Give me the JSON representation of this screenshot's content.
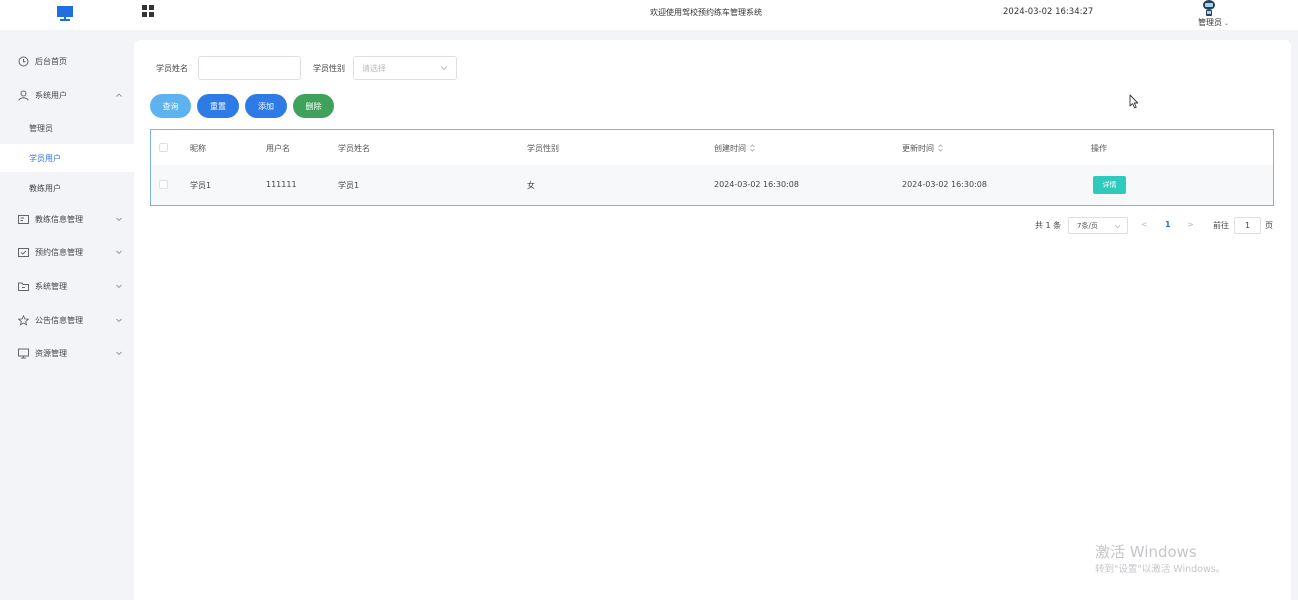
{
  "header": {
    "system_title": "欢迎使用驾校预约练车管理系统",
    "datetime": "2024-03-02 16:34:27",
    "user_role": "管理员",
    "icons": {
      "logo": "monitor-icon",
      "menu": "grid-icon",
      "avatar": "robot-avatar-icon"
    }
  },
  "sidebar": {
    "items": [
      {
        "label": "后台首页",
        "icon": "clock-icon"
      },
      {
        "label": "系统用户",
        "icon": "user-icon",
        "expanded": true,
        "children": [
          {
            "label": "管理员"
          },
          {
            "label": "学员用户",
            "active": true
          },
          {
            "label": "教练用户"
          }
        ]
      },
      {
        "label": "教练信息管理",
        "icon": "id-card-icon"
      },
      {
        "label": "预约信息管理",
        "icon": "calendar-check-icon"
      },
      {
        "label": "系统管理",
        "icon": "folder-icon"
      },
      {
        "label": "公告信息管理",
        "icon": "star-icon"
      },
      {
        "label": "资源管理",
        "icon": "monitor-icon"
      }
    ]
  },
  "search": {
    "name_label": "学员姓名",
    "name_value": "",
    "gender_label": "学员性别",
    "gender_placeholder": "请选择"
  },
  "actions": {
    "query": "查询",
    "reset": "重置",
    "add": "添加",
    "delete": "删除"
  },
  "colors": {
    "query": "#5cb3f0",
    "reset": "#2f7be5",
    "add": "#2f7be5",
    "delete": "#3fa25a",
    "detail": "#2ecbbd",
    "active": "#2f6fe0"
  },
  "table": {
    "columns": [
      "昵称",
      "用户名",
      "学员姓名",
      "学员性别",
      "创建时间",
      "更新时间",
      "操作"
    ],
    "rows": [
      {
        "nickname": "学员1",
        "username": "111111",
        "name": "学员1",
        "gender": "女",
        "created": "2024-03-02 16:30:08",
        "updated": "2024-03-02 16:30:08",
        "action": "详情"
      }
    ]
  },
  "pagination": {
    "total": "共 1 条",
    "page_size": "7条/页",
    "current_page": "1",
    "goto_label": "前往",
    "goto_value": "1",
    "page_suffix": "页"
  },
  "watermark": {
    "line1": "激活 Windows",
    "line2": "转到\"设置\"以激活 Windows。"
  }
}
